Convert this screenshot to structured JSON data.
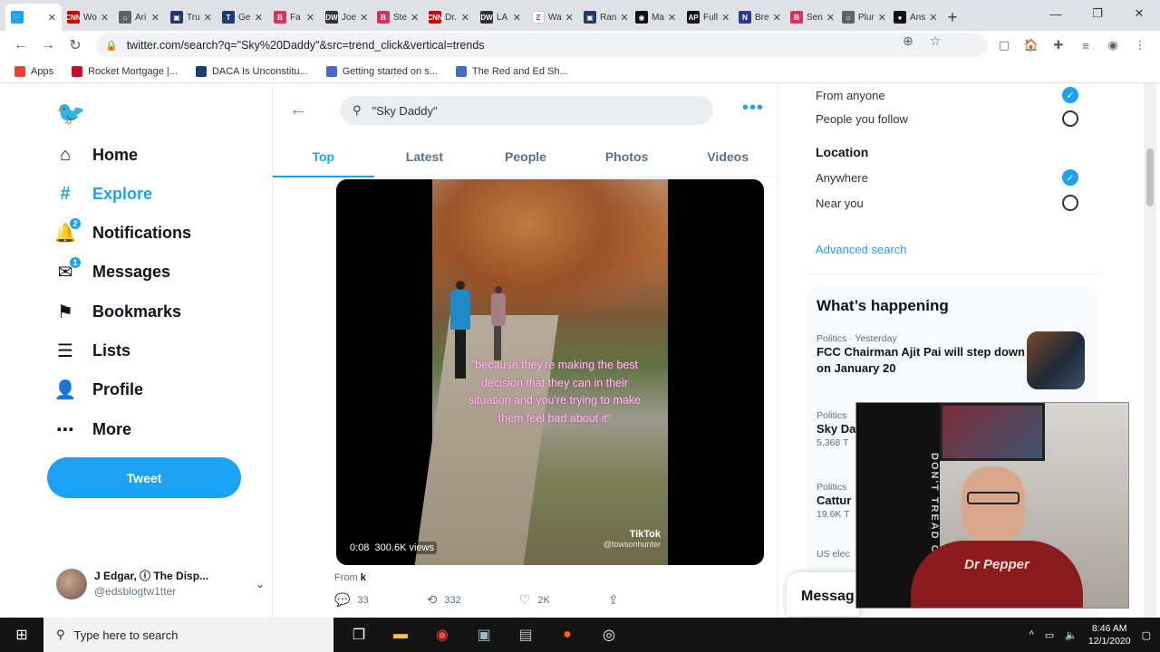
{
  "browser": {
    "tabs": [
      {
        "label": "",
        "color": "#1da1f2",
        "glyph": "🐦",
        "active": true
      },
      {
        "label": "Wo",
        "color": "#cc0000",
        "glyph": "CNN"
      },
      {
        "label": "Ari",
        "color": "#5f6368",
        "glyph": "⌂"
      },
      {
        "label": "Tru",
        "color": "#23395d",
        "glyph": "▣"
      },
      {
        "label": "Ge",
        "color": "#1a3e72",
        "glyph": "T"
      },
      {
        "label": "Fa",
        "color": "#d6335f",
        "glyph": "B"
      },
      {
        "label": "Joe",
        "color": "#333333",
        "glyph": "DW"
      },
      {
        "label": "Ste",
        "color": "#d6335f",
        "glyph": "B"
      },
      {
        "label": "Dr.",
        "color": "#cc0000",
        "glyph": "CNN"
      },
      {
        "label": "LA",
        "color": "#333333",
        "glyph": "DW"
      },
      {
        "label": "Wa",
        "color": "#ffffff",
        "glyph": "Z"
      },
      {
        "label": "Ran",
        "color": "#23395d",
        "glyph": "▣"
      },
      {
        "label": "Ma",
        "color": "#111111",
        "glyph": "◉"
      },
      {
        "label": "Full",
        "color": "#111111",
        "glyph": "AP"
      },
      {
        "label": "Bre",
        "color": "#2d3a8c",
        "glyph": "N"
      },
      {
        "label": "Sen",
        "color": "#d6335f",
        "glyph": "B"
      },
      {
        "label": "Plur",
        "color": "#5f6368",
        "glyph": "⌂"
      },
      {
        "label": "Ans",
        "color": "#111111",
        "glyph": "●"
      }
    ],
    "url": "twitter.com/search?q=\"Sky%20Daddy\"&src=trend_click&vertical=trends",
    "bookmarks": [
      {
        "label": "Apps",
        "color": "#ea4335"
      },
      {
        "label": "Rocket Mortgage |...",
        "color": "#c8102e"
      },
      {
        "label": "DACA Is Unconstitu...",
        "color": "#1a3e72"
      },
      {
        "label": "Getting started on s...",
        "color": "#4a68c8"
      },
      {
        "label": "The Red and Ed Sh...",
        "color": "#4a68c8"
      }
    ]
  },
  "nav": {
    "items": [
      {
        "label": "Home",
        "icon": "home-icon",
        "glyph": "⌂"
      },
      {
        "label": "Explore",
        "icon": "hashtag-icon",
        "glyph": "#"
      },
      {
        "label": "Notifications",
        "icon": "bell-icon",
        "glyph": "🔔",
        "badge": "2"
      },
      {
        "label": "Messages",
        "icon": "mail-icon",
        "glyph": "✉",
        "badge": "1"
      },
      {
        "label": "Bookmarks",
        "icon": "bookmark-icon",
        "glyph": "⚑"
      },
      {
        "label": "Lists",
        "icon": "list-icon",
        "glyph": "☰"
      },
      {
        "label": "Profile",
        "icon": "person-icon",
        "glyph": "👤"
      },
      {
        "label": "More",
        "icon": "more-icon",
        "glyph": "⋯"
      }
    ],
    "tweet_button": "Tweet",
    "account": {
      "name": "J Edgar, ⓘ The Disp...",
      "handle": "@edsblogtw1tter"
    }
  },
  "search": {
    "query": "\"Sky Daddy\"",
    "tabs": [
      "Top",
      "Latest",
      "People",
      "Photos",
      "Videos"
    ],
    "active_tab": "Top"
  },
  "tweet": {
    "caption": "\"because they're making the best decision that they can in their situation and you're trying to make them feel bad about it\"",
    "video_time": "0:08",
    "video_views": "300.6K views",
    "watermark": "TikTok",
    "watermark_handle": "@towsonhunter",
    "from_label": "From",
    "from_value": "k",
    "replies": "33",
    "retweets": "332",
    "likes": "2K"
  },
  "filters": {
    "from_anyone": "From anyone",
    "people_you_follow": "People you follow",
    "location_title": "Location",
    "anywhere": "Anywhere",
    "near_you": "Near you",
    "advanced": "Advanced search"
  },
  "whats_happening": {
    "title": "What’s happening",
    "trends": [
      {
        "meta": "Politics · Yesterday",
        "name": "FCC Chairman Ajit Pai will step down on January 20",
        "count": ""
      },
      {
        "meta": "Politics",
        "name": "Sky Da",
        "count": "5,368 T"
      },
      {
        "meta": "Politics",
        "name": "Cattur",
        "count": "19.6K T"
      },
      {
        "meta": "US elec",
        "name": "",
        "count": ""
      }
    ]
  },
  "webcam": {
    "shirt_text": "Dr Pepper"
  },
  "messages_drawer": "Messag",
  "taskbar": {
    "search_placeholder": "Type here to search",
    "time": "8:46 AM",
    "date": "12/1/2020"
  }
}
